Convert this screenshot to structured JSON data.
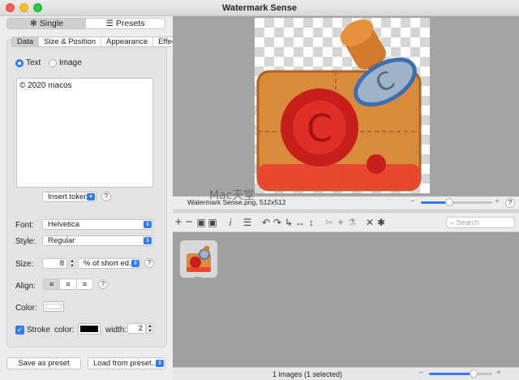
{
  "window": {
    "title": "Watermark Sense"
  },
  "mode_tabs": [
    {
      "label": "Single",
      "icon": "gear-icon",
      "selected": true
    },
    {
      "label": "Presets",
      "icon": "list-icon",
      "selected": false
    }
  ],
  "sub_tabs": [
    {
      "label": "Data",
      "selected": true
    },
    {
      "label": "Size & Position"
    },
    {
      "label": "Appearance"
    },
    {
      "label": "Effects"
    }
  ],
  "source": {
    "text_label": "Text",
    "image_label": "Image",
    "selected": "Text"
  },
  "watermark_text": "© 2020 macos",
  "insert_token": "Insert token",
  "font": {
    "label": "Font:",
    "value": "Helvetica"
  },
  "style": {
    "label": "Style:",
    "value": "Regular"
  },
  "size": {
    "label": "Size:",
    "value": "8",
    "unit": "% of short ed..."
  },
  "align": {
    "label": "Align:",
    "options": [
      "left",
      "center",
      "right"
    ],
    "selected": "left"
  },
  "color": {
    "label": "Color:",
    "value": "#ffffff"
  },
  "stroke": {
    "label": "Stroke",
    "checked": true,
    "color_label": "color:",
    "color": "#000000",
    "width_label": "width:",
    "width": "2"
  },
  "bottom_buttons": {
    "save": "Save as preset",
    "load": "Load from preset..."
  },
  "preview": {
    "caption": "Watermark Sense.png, 512x512",
    "watermark_overlay": "Mac天堂",
    "zoom_level": 0.4
  },
  "toolbar": {
    "search_placeholder": "Search"
  },
  "browser": {
    "items": [
      {
        "label": "..."
      }
    ]
  },
  "status": {
    "text": "1 images (1 selected)",
    "zoom_level": 0.7
  },
  "colors": {
    "accent": "#2f7cf6",
    "preview_bg": "#a4a4a4",
    "browser_bg": "#a0a0a0"
  }
}
